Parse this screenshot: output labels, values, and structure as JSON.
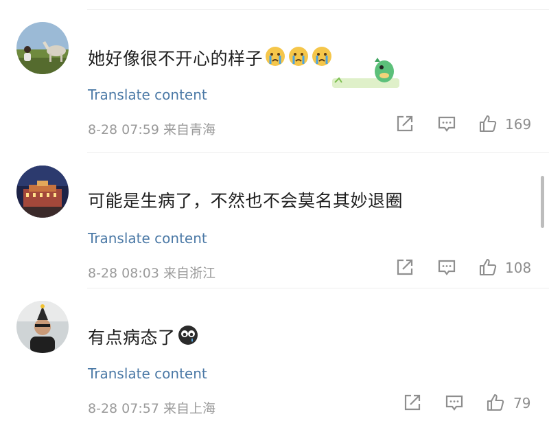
{
  "comments": [
    {
      "text": "她好像很不开心的样子",
      "translate_label": "Translate content",
      "meta": "8-28 07:59 来自青海",
      "likes": "169",
      "emoji_count": 3,
      "avatar": "person-with-horse-on-grassland"
    },
    {
      "text": "可能是生病了，不然也不会莫名其妙退圈",
      "translate_label": "Translate content",
      "meta": "8-28 08:03 来自浙江",
      "likes": "108",
      "avatar": "illuminated-building-at-night"
    },
    {
      "text": "有点病态了",
      "translate_label": "Translate content",
      "meta": "8-28 07:57 来自上海",
      "likes": "79",
      "avatar": "person-wearing-party-hat"
    }
  ],
  "icons": {
    "share": "share-icon",
    "reply": "comment-icon",
    "like": "thumbs-up-icon"
  },
  "colors": {
    "link": "#4b79a6",
    "meta": "#9a9a9a"
  }
}
